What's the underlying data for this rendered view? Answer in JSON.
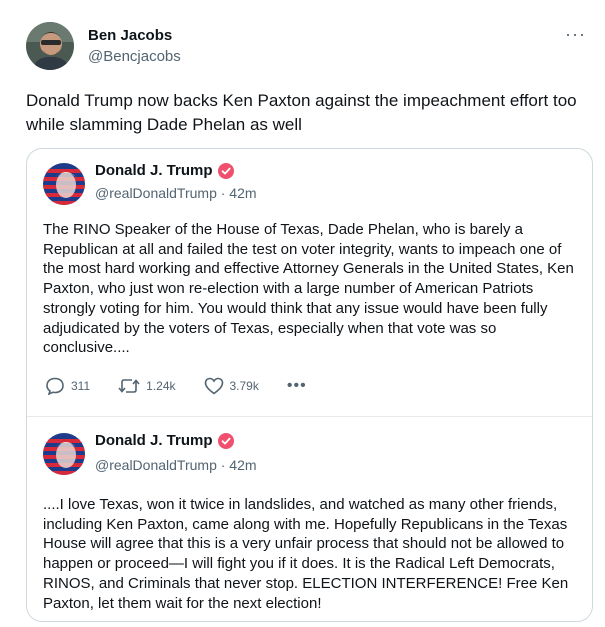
{
  "tweet": {
    "author": {
      "name": "Ben Jacobs",
      "handle": "@Bencjacobs"
    },
    "more_label": "···",
    "text": "Donald Trump now backs Ken Paxton against the impeachment effort too while slamming Dade Phelan as well",
    "embedded_posts": [
      {
        "name": "Donald J. Trump",
        "meta": "@realDonaldTrump · 42m",
        "body": "The RINO Speaker of the House of Texas, Dade Phelan, who is barely a Republican at all and failed the test on voter integrity, wants to impeach one of the most hard working and effective Attorney Generals in the United States, Ken Paxton, who just won re-election with a large number of American Patriots strongly voting for him. You would think that any issue would have been fully adjudicated by the voters of Texas, especially when that vote was so conclusive....",
        "actions": {
          "replies": "311",
          "reposts": "1.24k",
          "likes": "3.79k",
          "more": "•••"
        }
      },
      {
        "name": "Donald J. Trump",
        "meta": "@realDonaldTrump · 42m",
        "body": "....I love Texas, won it twice in landslides, and watched as many other friends, including Ken Paxton, came along with me. Hopefully Republicans in the Texas House will agree that this is a very unfair process that should not be allowed to happen or proceed—I will fight you if it does. It is the Radical Left Democrats, RINOS, and Criminals that never stop. ELECTION INTERFERENCE! Free Ken Paxton, let them wait for the next election!"
      }
    ],
    "icons": {
      "avatar": "avatar-photo",
      "verified": "verified-badge-icon",
      "reply": "reply-icon",
      "repost": "repost-icon",
      "like": "heart-icon"
    },
    "colors": {
      "text": "#0f1419",
      "secondary": "#536471",
      "border": "#cfd9de",
      "verified_badge": "#f0506e"
    }
  }
}
